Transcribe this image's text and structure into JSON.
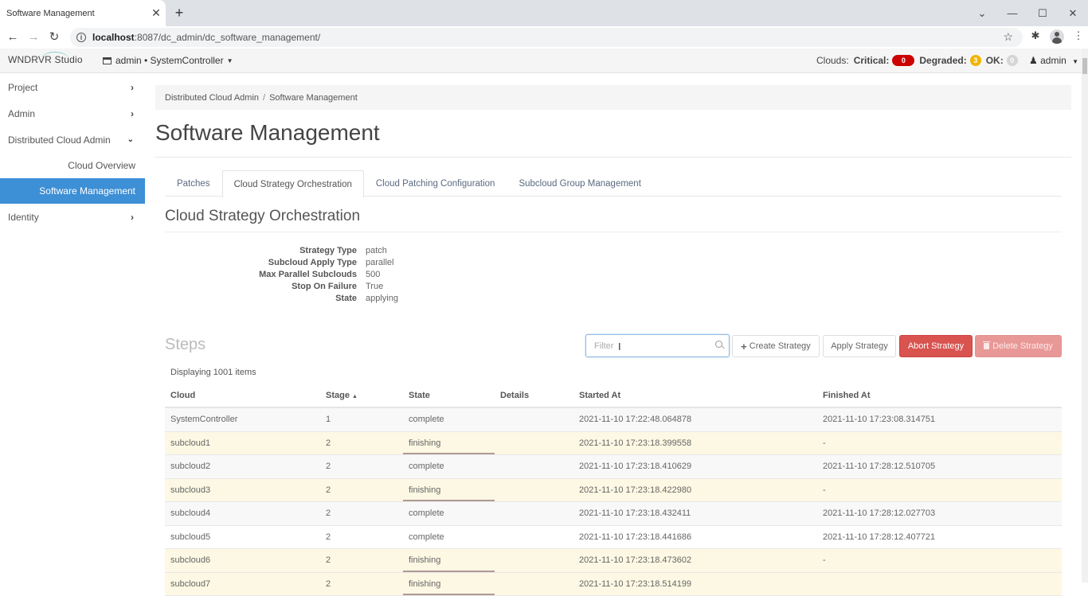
{
  "browser": {
    "tab_title": "Software Management",
    "url_host": "localhost",
    "url_rest": ":8087/dc_admin/dc_software_management/"
  },
  "header": {
    "logo": "WNDRVR Studio",
    "project": "admin • SystemController",
    "clouds_label": "Clouds:",
    "critical_label": "Critical:",
    "critical_count": "0",
    "degraded_label": "Degraded:",
    "degraded_count": "3",
    "ok_label": "OK:",
    "ok_count": "0",
    "user": "admin",
    "colors": {
      "critical": "#cc0000",
      "degraded": "#f0b400",
      "ok": "#d5d5d5"
    }
  },
  "sidebar": {
    "items": [
      {
        "label": "Project",
        "icon": "chevron-right-icon"
      },
      {
        "label": "Admin",
        "icon": "chevron-right-icon"
      },
      {
        "label": "Distributed Cloud Admin",
        "icon": "chevron-down-icon"
      },
      {
        "label": "Cloud Overview"
      },
      {
        "label": "Software Management",
        "active": true
      },
      {
        "label": "Identity",
        "icon": "chevron-right-icon"
      }
    ]
  },
  "breadcrumb": [
    "Distributed Cloud Admin",
    "Software Management"
  ],
  "page_title": "Software Management",
  "tabs": [
    {
      "label": "Patches"
    },
    {
      "label": "Cloud Strategy Orchestration",
      "active": true
    },
    {
      "label": "Cloud Patching Configuration"
    },
    {
      "label": "Subcloud Group Management"
    }
  ],
  "section_title": "Cloud Strategy Orchestration",
  "strategy": [
    {
      "key": "Strategy Type",
      "value": "patch"
    },
    {
      "key": "Subcloud Apply Type",
      "value": "parallel"
    },
    {
      "key": "Max Parallel Subclouds",
      "value": "500"
    },
    {
      "key": "Stop On Failure",
      "value": "True"
    },
    {
      "key": "State",
      "value": "applying"
    }
  ],
  "steps": {
    "title": "Steps",
    "filter_placeholder": "Filter",
    "buttons": {
      "create": "Create Strategy",
      "apply": "Apply Strategy",
      "abort": "Abort Strategy",
      "delete": "Delete Strategy"
    },
    "count_text": "Displaying 1001 items",
    "columns": [
      "Cloud",
      "Stage",
      "State",
      "Details",
      "Started At",
      "Finished At"
    ],
    "rows": [
      {
        "cloud": "SystemController",
        "stage": "1",
        "state": "complete",
        "details": "",
        "started": "2021-11-10 17:22:48.064878",
        "finished": "2021-11-10 17:23:08.314751"
      },
      {
        "cloud": "subcloud1",
        "stage": "2",
        "state": "finishing",
        "details": "",
        "started": "2021-11-10 17:23:18.399558",
        "finished": "-",
        "progress": 1.0
      },
      {
        "cloud": "subcloud2",
        "stage": "2",
        "state": "complete",
        "details": "",
        "started": "2021-11-10 17:23:18.410629",
        "finished": "2021-11-10 17:28:12.510705"
      },
      {
        "cloud": "subcloud3",
        "stage": "2",
        "state": "finishing",
        "details": "",
        "started": "2021-11-10 17:23:18.422980",
        "finished": "-",
        "progress": 1.0
      },
      {
        "cloud": "subcloud4",
        "stage": "2",
        "state": "complete",
        "details": "",
        "started": "2021-11-10 17:23:18.432411",
        "finished": "2021-11-10 17:28:12.027703"
      },
      {
        "cloud": "subcloud5",
        "stage": "2",
        "state": "complete",
        "details": "",
        "started": "2021-11-10 17:23:18.441686",
        "finished": "2021-11-10 17:28:12.407721"
      },
      {
        "cloud": "subcloud6",
        "stage": "2",
        "state": "finishing",
        "details": "",
        "started": "2021-11-10 17:23:18.473602",
        "finished": "-",
        "progress": 1.0
      },
      {
        "cloud": "subcloud7",
        "stage": "2",
        "state": "finishing",
        "details": "",
        "started": "2021-11-10 17:23:18.514199",
        "finished": "",
        "progress": 1.0
      }
    ]
  }
}
